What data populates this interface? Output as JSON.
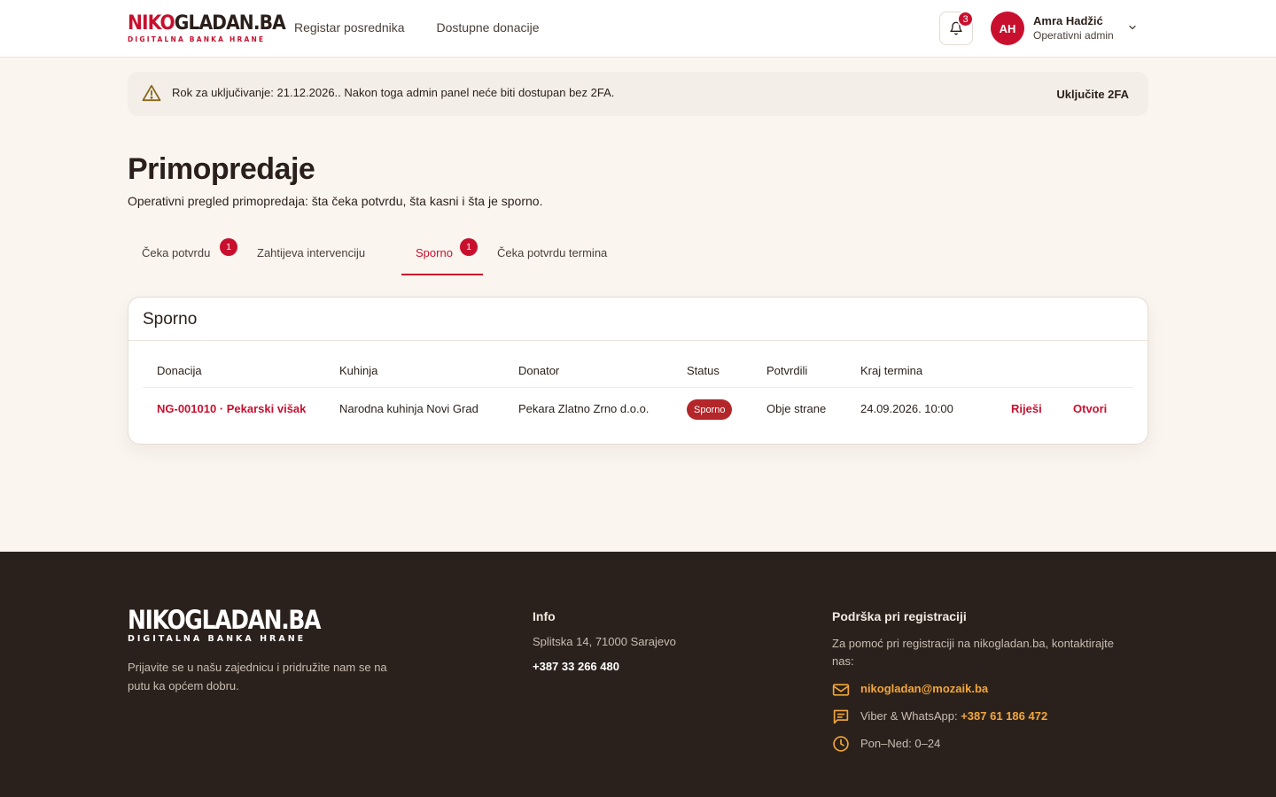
{
  "header": {
    "logo_main_part1": "NIKO",
    "logo_main_part2": "GLADAN.BA",
    "logo_sub": "DIGITALNA BANKA HRANE",
    "nav": [
      "Registar posrednika",
      "Dostupne donacije"
    ],
    "notifications_count": "3",
    "user": {
      "initials": "AH",
      "name": "Amra Hadžić",
      "role": "Operativni admin"
    }
  },
  "alert": {
    "text": "Rok za uključivanje: 21.12.2026.. Nakon toga admin panel neće biti dostupan bez 2FA.",
    "action": "Uključite 2FA"
  },
  "page": {
    "title": "Primopredaje",
    "subtitle": "Operativni pregled primopredaja: šta čeka potvrdu, šta kasni i šta je sporno."
  },
  "tabs": [
    {
      "label": "Čeka potvrdu",
      "badge": "1"
    },
    {
      "label": "Zahtijeva intervenciju",
      "badge": ""
    },
    {
      "label": "Sporno",
      "badge": "1"
    },
    {
      "label": "Čeka potvrdu termina",
      "badge": ""
    }
  ],
  "active_tab": "Sporno",
  "table": {
    "title": "Sporno",
    "columns": [
      "Donacija",
      "Kuhinja",
      "Donator",
      "Status",
      "Potvrdili",
      "Kraj termina"
    ],
    "rows": [
      {
        "donacija": "NG-001010 · Pekarski višak",
        "kuhinja": "Narodna kuhinja Novi Grad",
        "donator": "Pekara Zlatno Zrno d.o.o.",
        "status": "Sporno",
        "potvrdili": "Obje strane",
        "kraj": "24.09.2026. 10:00",
        "action_resolve": "Riješi",
        "action_open": "Otvori"
      }
    ]
  },
  "footer": {
    "logo_main": "NIKOGLADAN.BA",
    "logo_sub": "DIGITALNA BANKA HRANE",
    "description": "Prijavite se u našu zajednicu i pridružite nam se na putu ka općem dobru.",
    "info": {
      "title": "Info",
      "address": "Splitska 14, 71000 Sarajevo",
      "phone": "+387 33 266 480"
    },
    "support": {
      "title": "Podrška pri registraciji",
      "text": "Za pomoć pri registraciji na nikogladan.ba, kontaktirajte nas:",
      "email": "nikogladan@mozaik.ba",
      "messenger_label": "Viber & WhatsApp:",
      "messenger_phone": "+387 61 186 472",
      "hours": "Pon–Ned: 0–24"
    }
  },
  "colors": {
    "brand": "#c8102e",
    "footer_bg": "#2b211c",
    "accent": "#f2a63a",
    "page_bg": "#faf5ef"
  }
}
